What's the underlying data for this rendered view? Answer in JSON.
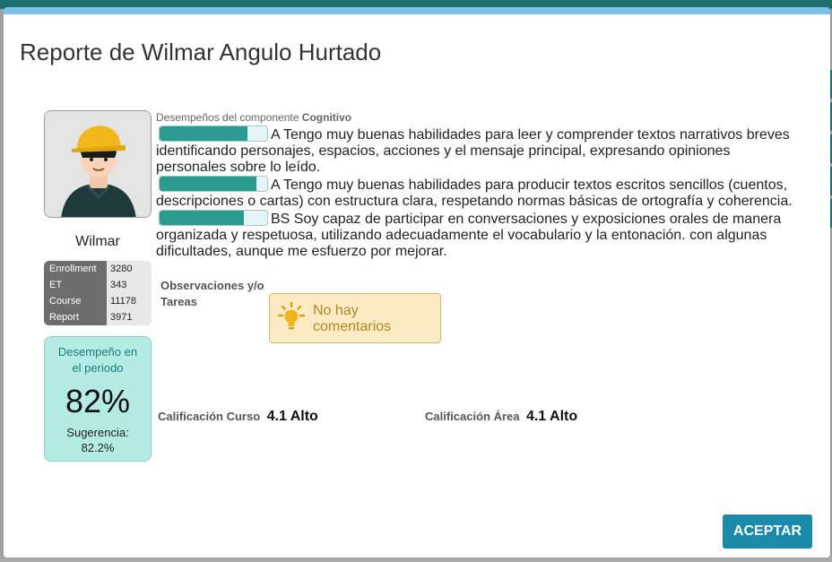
{
  "modal": {
    "title": "Reporte de Wilmar Angulo Hurtado"
  },
  "student": {
    "name": "Wilmar",
    "stats": [
      {
        "label": "Enrollment",
        "value": "3280"
      },
      {
        "label": "ET",
        "value": "343"
      },
      {
        "label": "Course",
        "value": "11178"
      },
      {
        "label": "Report",
        "value": "3971"
      }
    ]
  },
  "performance": {
    "label": "Desempeño en el periodo",
    "value": "82%",
    "suggestion_label": "Sugerencia:",
    "suggestion_value": "82.2%"
  },
  "component": {
    "header_prefix": "Desempeños del componente",
    "header_name": "Cognitivo",
    "items": [
      {
        "grade": "A",
        "fill": 0.82,
        "text": "Tengo muy buenas habilidades para leer y comprender textos narrativos breves identificando personajes, espacios, acciones y el mensaje principal, expresando opiniones personales sobre lo leído."
      },
      {
        "grade": "A",
        "fill": 0.9,
        "text": "Tengo muy buenas habilidades para producir textos escritos sencillos (cuentos, descripciones o cartas) con estructura clara, respetando normas básicas de ortografía y coherencia."
      },
      {
        "grade": "BS",
        "fill": 0.78,
        "text": "Soy capaz de participar en conversaciones y exposiciones orales de manera organizada y respetuosa, utilizando adecuadamente el vocabulario y la entonación. con algunas dificultades, aunque me esfuerzo por mejorar."
      }
    ]
  },
  "observations": {
    "label": "Observaciones y/o Tareas",
    "empty_message": "No hay comentarios"
  },
  "grades": {
    "course_label": "Calificación Curso",
    "course_value": "4.1 Alto",
    "area_label": "Calificación Área",
    "area_value": "4.1 Alto"
  },
  "actions": {
    "accept_label": "ACEPTAR"
  },
  "colors": {
    "accent": "#1a8aa8",
    "bar_fill": "#2a9b8e",
    "performance_bg": "#b4ebe5",
    "notice_bg": "#fdebc6"
  }
}
